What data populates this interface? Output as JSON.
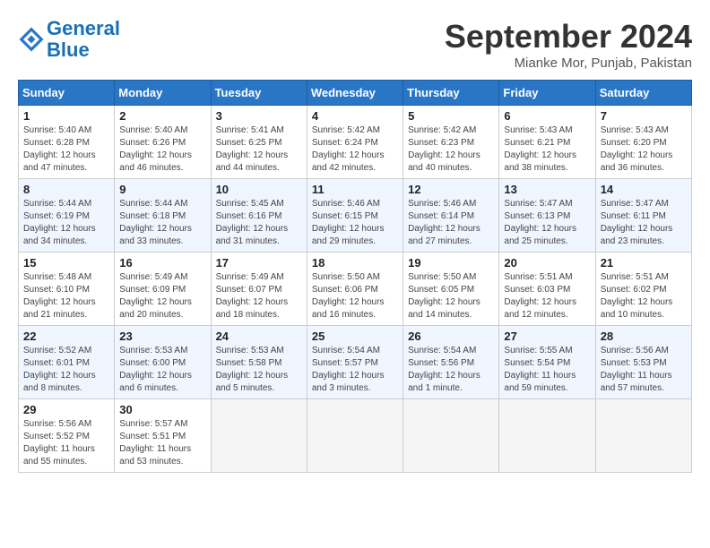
{
  "header": {
    "logo_line1": "General",
    "logo_line2": "Blue",
    "month": "September 2024",
    "location": "Mianke Mor, Punjab, Pakistan"
  },
  "columns": [
    "Sunday",
    "Monday",
    "Tuesday",
    "Wednesday",
    "Thursday",
    "Friday",
    "Saturday"
  ],
  "weeks": [
    [
      {
        "day": "1",
        "sunrise": "Sunrise: 5:40 AM",
        "sunset": "Sunset: 6:28 PM",
        "daylight": "Daylight: 12 hours and 47 minutes."
      },
      {
        "day": "2",
        "sunrise": "Sunrise: 5:40 AM",
        "sunset": "Sunset: 6:26 PM",
        "daylight": "Daylight: 12 hours and 46 minutes."
      },
      {
        "day": "3",
        "sunrise": "Sunrise: 5:41 AM",
        "sunset": "Sunset: 6:25 PM",
        "daylight": "Daylight: 12 hours and 44 minutes."
      },
      {
        "day": "4",
        "sunrise": "Sunrise: 5:42 AM",
        "sunset": "Sunset: 6:24 PM",
        "daylight": "Daylight: 12 hours and 42 minutes."
      },
      {
        "day": "5",
        "sunrise": "Sunrise: 5:42 AM",
        "sunset": "Sunset: 6:23 PM",
        "daylight": "Daylight: 12 hours and 40 minutes."
      },
      {
        "day": "6",
        "sunrise": "Sunrise: 5:43 AM",
        "sunset": "Sunset: 6:21 PM",
        "daylight": "Daylight: 12 hours and 38 minutes."
      },
      {
        "day": "7",
        "sunrise": "Sunrise: 5:43 AM",
        "sunset": "Sunset: 6:20 PM",
        "daylight": "Daylight: 12 hours and 36 minutes."
      }
    ],
    [
      {
        "day": "8",
        "sunrise": "Sunrise: 5:44 AM",
        "sunset": "Sunset: 6:19 PM",
        "daylight": "Daylight: 12 hours and 34 minutes."
      },
      {
        "day": "9",
        "sunrise": "Sunrise: 5:44 AM",
        "sunset": "Sunset: 6:18 PM",
        "daylight": "Daylight: 12 hours and 33 minutes."
      },
      {
        "day": "10",
        "sunrise": "Sunrise: 5:45 AM",
        "sunset": "Sunset: 6:16 PM",
        "daylight": "Daylight: 12 hours and 31 minutes."
      },
      {
        "day": "11",
        "sunrise": "Sunrise: 5:46 AM",
        "sunset": "Sunset: 6:15 PM",
        "daylight": "Daylight: 12 hours and 29 minutes."
      },
      {
        "day": "12",
        "sunrise": "Sunrise: 5:46 AM",
        "sunset": "Sunset: 6:14 PM",
        "daylight": "Daylight: 12 hours and 27 minutes."
      },
      {
        "day": "13",
        "sunrise": "Sunrise: 5:47 AM",
        "sunset": "Sunset: 6:13 PM",
        "daylight": "Daylight: 12 hours and 25 minutes."
      },
      {
        "day": "14",
        "sunrise": "Sunrise: 5:47 AM",
        "sunset": "Sunset: 6:11 PM",
        "daylight": "Daylight: 12 hours and 23 minutes."
      }
    ],
    [
      {
        "day": "15",
        "sunrise": "Sunrise: 5:48 AM",
        "sunset": "Sunset: 6:10 PM",
        "daylight": "Daylight: 12 hours and 21 minutes."
      },
      {
        "day": "16",
        "sunrise": "Sunrise: 5:49 AM",
        "sunset": "Sunset: 6:09 PM",
        "daylight": "Daylight: 12 hours and 20 minutes."
      },
      {
        "day": "17",
        "sunrise": "Sunrise: 5:49 AM",
        "sunset": "Sunset: 6:07 PM",
        "daylight": "Daylight: 12 hours and 18 minutes."
      },
      {
        "day": "18",
        "sunrise": "Sunrise: 5:50 AM",
        "sunset": "Sunset: 6:06 PM",
        "daylight": "Daylight: 12 hours and 16 minutes."
      },
      {
        "day": "19",
        "sunrise": "Sunrise: 5:50 AM",
        "sunset": "Sunset: 6:05 PM",
        "daylight": "Daylight: 12 hours and 14 minutes."
      },
      {
        "day": "20",
        "sunrise": "Sunrise: 5:51 AM",
        "sunset": "Sunset: 6:03 PM",
        "daylight": "Daylight: 12 hours and 12 minutes."
      },
      {
        "day": "21",
        "sunrise": "Sunrise: 5:51 AM",
        "sunset": "Sunset: 6:02 PM",
        "daylight": "Daylight: 12 hours and 10 minutes."
      }
    ],
    [
      {
        "day": "22",
        "sunrise": "Sunrise: 5:52 AM",
        "sunset": "Sunset: 6:01 PM",
        "daylight": "Daylight: 12 hours and 8 minutes."
      },
      {
        "day": "23",
        "sunrise": "Sunrise: 5:53 AM",
        "sunset": "Sunset: 6:00 PM",
        "daylight": "Daylight: 12 hours and 6 minutes."
      },
      {
        "day": "24",
        "sunrise": "Sunrise: 5:53 AM",
        "sunset": "Sunset: 5:58 PM",
        "daylight": "Daylight: 12 hours and 5 minutes."
      },
      {
        "day": "25",
        "sunrise": "Sunrise: 5:54 AM",
        "sunset": "Sunset: 5:57 PM",
        "daylight": "Daylight: 12 hours and 3 minutes."
      },
      {
        "day": "26",
        "sunrise": "Sunrise: 5:54 AM",
        "sunset": "Sunset: 5:56 PM",
        "daylight": "Daylight: 12 hours and 1 minute."
      },
      {
        "day": "27",
        "sunrise": "Sunrise: 5:55 AM",
        "sunset": "Sunset: 5:54 PM",
        "daylight": "Daylight: 11 hours and 59 minutes."
      },
      {
        "day": "28",
        "sunrise": "Sunrise: 5:56 AM",
        "sunset": "Sunset: 5:53 PM",
        "daylight": "Daylight: 11 hours and 57 minutes."
      }
    ],
    [
      {
        "day": "29",
        "sunrise": "Sunrise: 5:56 AM",
        "sunset": "Sunset: 5:52 PM",
        "daylight": "Daylight: 11 hours and 55 minutes."
      },
      {
        "day": "30",
        "sunrise": "Sunrise: 5:57 AM",
        "sunset": "Sunset: 5:51 PM",
        "daylight": "Daylight: 11 hours and 53 minutes."
      },
      null,
      null,
      null,
      null,
      null
    ]
  ]
}
